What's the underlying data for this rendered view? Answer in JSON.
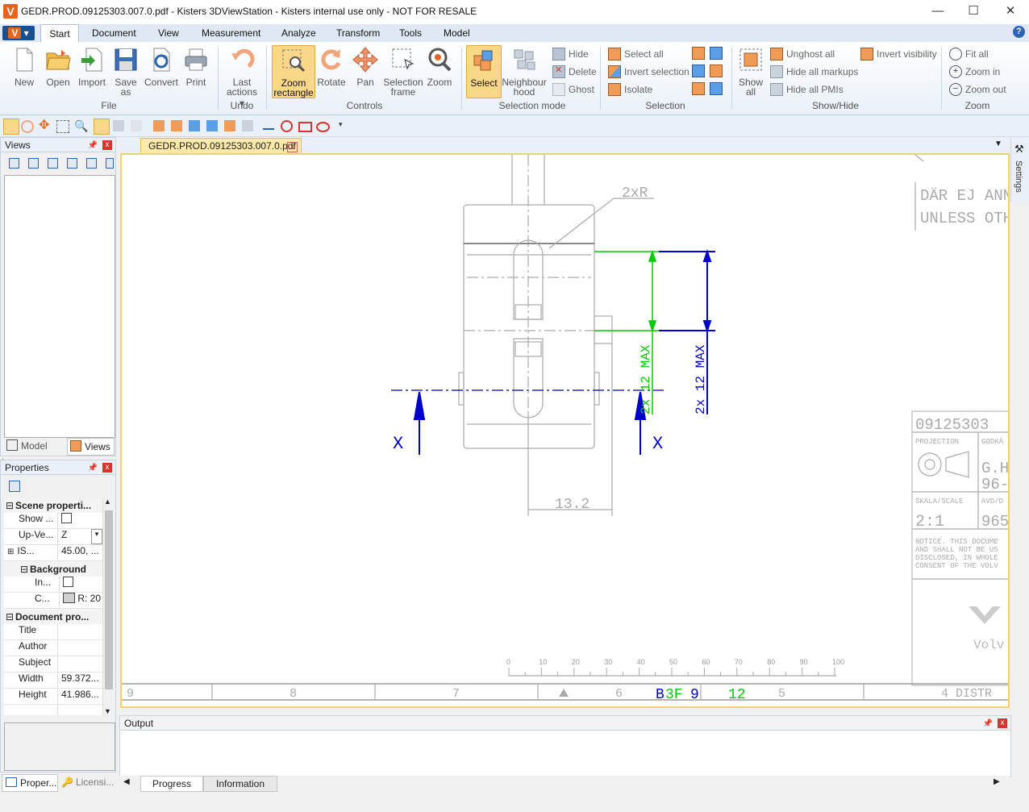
{
  "window": {
    "title": "GEDR.PROD.09125303.007.0.pdf - Kisters 3DViewStation - Kisters internal use only - NOT FOR RESALE",
    "app_logo": "V",
    "minimize": "—",
    "maximize": "☐",
    "close": "✕"
  },
  "ribbon_tabs": [
    "Start",
    "Document",
    "View",
    "Measurement",
    "Analyze",
    "Transform",
    "Tools",
    "Model"
  ],
  "help": "?",
  "ribbon": {
    "file": {
      "label": "File",
      "buttons": [
        "New",
        "Open",
        "Import",
        "Save",
        "as",
        "Convert",
        "Print"
      ]
    },
    "undo": {
      "label": "Undo",
      "last_actions": "Last",
      "last_actions_2": "actions ▾"
    },
    "controls": {
      "label": "Controls",
      "zoom_rect_1": "Zoom",
      "zoom_rect_2": "rectangle",
      "rotate": "Rotate",
      "pan": "Pan",
      "selframe_1": "Selection",
      "selframe_2": "frame",
      "zoom": "Zoom"
    },
    "selection_mode": {
      "label": "Selection mode",
      "select": "Select",
      "neigh_1": "Neighbour",
      "neigh_2": "hood",
      "hide": "Hide",
      "delete": "Delete",
      "ghost": "Ghost"
    },
    "selection": {
      "label": "Selection",
      "select_all": "Select all",
      "invert_selection": "Invert selection",
      "isolate": "Isolate"
    },
    "showhide": {
      "label": "Show/Hide",
      "show_1": "Show",
      "show_2": "all",
      "unghost_all": "Unghost all",
      "hide_all_markups": "Hide all markups",
      "hide_all_pmis": "Hide all PMIs",
      "invert_visibility": "Invert visibility"
    },
    "zoom": {
      "label": "Zoom",
      "fit_all": "Fit all",
      "zoom_in": "Zoom in",
      "zoom_out": "Zoom out"
    }
  },
  "views_panel": {
    "title": "Views",
    "pin": "📌",
    "close": "x"
  },
  "left_tabs": {
    "model_tree": "Model tree",
    "views": "Views"
  },
  "properties_panel": {
    "title": "Properties",
    "scene_properties": "Scene properti...",
    "show": "Show ...",
    "up_vector": "Up-Ve...",
    "up_vector_value": "Z",
    "is": "IS...",
    "is_value": "45.00, ...",
    "background": "Background",
    "in": "In...",
    "c": "C...",
    "c_value": "R: 20",
    "document_properties": "Document pro...",
    "rows": [
      {
        "k": "Title",
        "v": ""
      },
      {
        "k": "Author",
        "v": ""
      },
      {
        "k": "Subject",
        "v": ""
      },
      {
        "k": "Width",
        "v": "59.372..."
      },
      {
        "k": "Height",
        "v": "41.986..."
      }
    ]
  },
  "bottom_left_tabs": {
    "properties": "Proper...",
    "licensing": "Licensi..."
  },
  "document_tab": {
    "label": "GEDR.PROD.09125303.007.0.pdf",
    "close": "x"
  },
  "settings_label": "Settings",
  "drawing": {
    "radius_note": "2xR",
    "dim_green": "2x 12 MAX",
    "dim_blue": "2x 12 MAX",
    "dim_width": "13.2",
    "section_left": "X",
    "section_right": "X",
    "title_block_number": "09125303",
    "projection": "PROJECTION",
    "gocka": "GODKÄ",
    "gh": "G.H",
    "ninety_six": "96-",
    "scale_label": "SKALA/SCALE",
    "avd": "AVD/D",
    "scale_value": "2:1",
    "avd_value": "965",
    "notice_1": "NOTICE. THIS DOCUME",
    "notice_2": "AND SHALL NOT BE US",
    "notice_3": "DISCLOSED, IN WHOLE",
    "notice_4": "CONSENT OF THE VOLV",
    "volvo": "Volv",
    "dar_ej": "DÄR EJ ANN",
    "unless": "UNLESS OTH",
    "ruler": [
      "0",
      "10",
      "20",
      "30",
      "40",
      "50",
      "60",
      "70",
      "80",
      "90",
      "100"
    ],
    "zones": [
      "9",
      "8",
      "7",
      "6",
      "5",
      "4 DISTR"
    ],
    "zone_code_blue": "B",
    "zone_code_green": "3F",
    "zone_code_mid": "9",
    "zone_code_tail": "12"
  },
  "output_panel": {
    "title": "Output",
    "tabs": [
      "Progress",
      "Information"
    ]
  }
}
